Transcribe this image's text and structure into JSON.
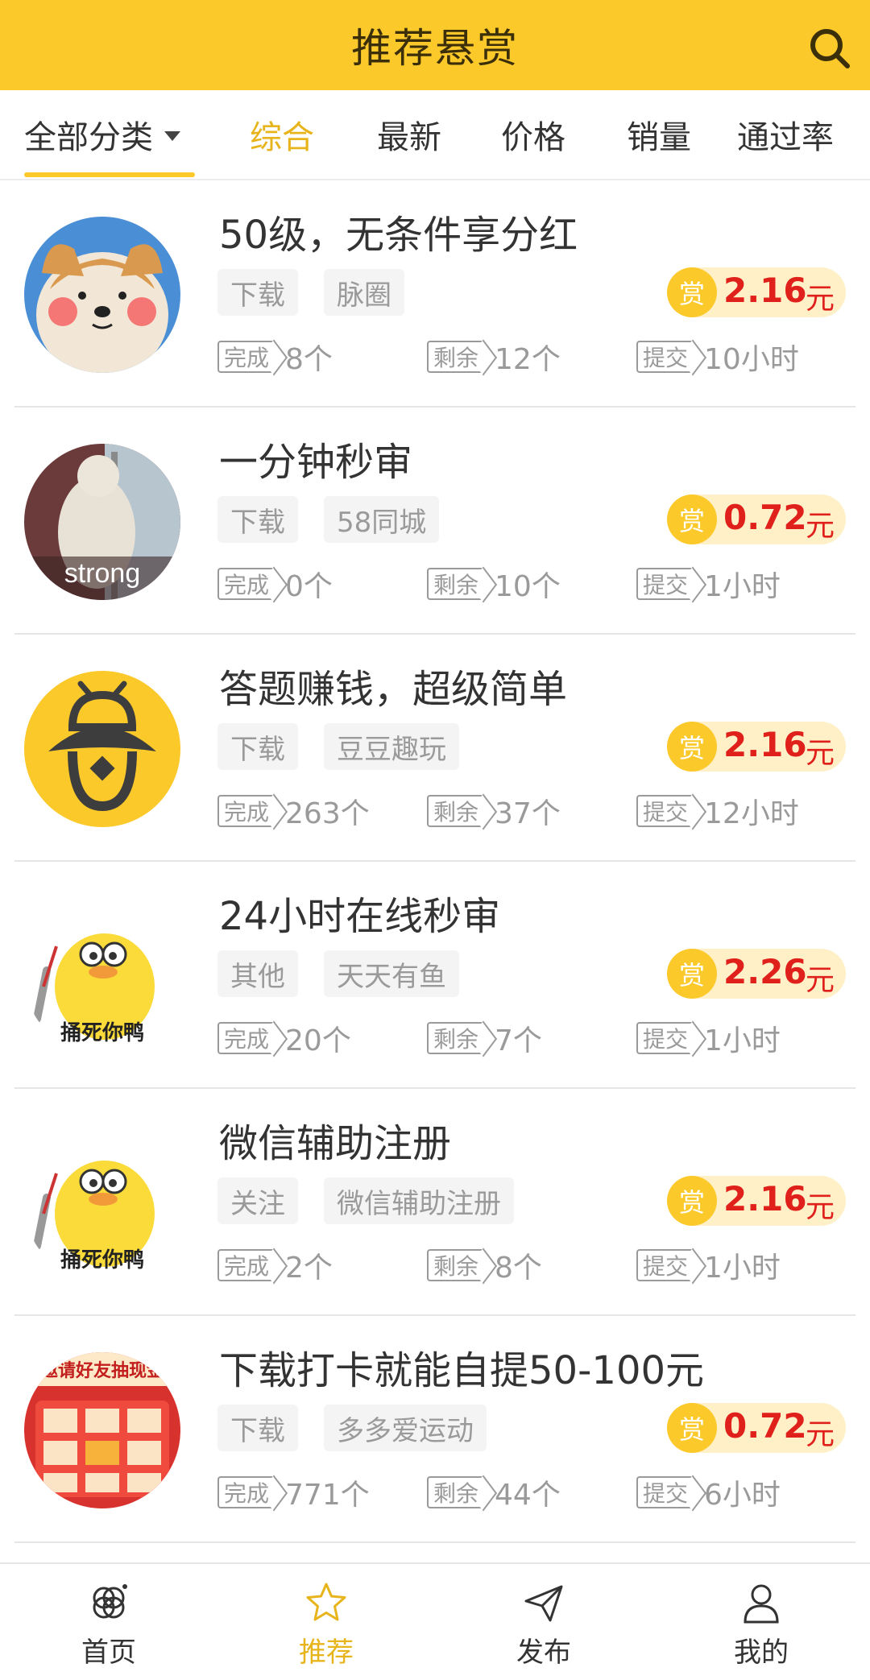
{
  "header": {
    "title": "推荐悬赏"
  },
  "tabs": {
    "all": "全部分类",
    "items": [
      "综合",
      "最新",
      "价格",
      "销量",
      "通过率"
    ]
  },
  "labels": {
    "done": "完成",
    "left": "剩余",
    "submit": "提交",
    "reward_coin": "赏",
    "currency": "元"
  },
  "tasks": [
    {
      "title": "50级，无条件享分红",
      "tag1": "下载",
      "tag2": "脉圈",
      "reward": "2.16",
      "done": "8个",
      "left": "12个",
      "submit": "10小时",
      "avatar": "shiba-dog-avatar"
    },
    {
      "title": "一分钟秒审",
      "tag1": "下载",
      "tag2": "58同城",
      "reward": "0.72",
      "done": "0个",
      "left": "10个",
      "submit": "1小时",
      "avatar": "strong-cat-avatar",
      "avatar_text": "strong"
    },
    {
      "title": "答题赚钱，超级简单",
      "tag1": "下载",
      "tag2": "豆豆趣玩",
      "reward": "2.16",
      "done": "263个",
      "left": "37个",
      "submit": "12小时",
      "avatar": "bee-logo-avatar"
    },
    {
      "title": "24小时在线秒审",
      "tag1": "其他",
      "tag2": "天天有鱼",
      "reward": "2.26",
      "done": "20个",
      "left": "7个",
      "submit": "1小时",
      "avatar": "duck-knife-avatar",
      "avatar_text": "捅死你鸭"
    },
    {
      "title": "微信辅助注册",
      "tag1": "关注",
      "tag2": "微信辅助注册",
      "reward": "2.16",
      "done": "2个",
      "left": "8个",
      "submit": "1小时",
      "avatar": "duck-knife-avatar",
      "avatar_text": "捅死你鸭"
    },
    {
      "title": "下载打卡就能自提50-100元",
      "tag1": "下载",
      "tag2": "多多爱运动",
      "reward": "0.72",
      "done": "771个",
      "left": "44个",
      "submit": "6小时",
      "avatar": "invite-friends-avatar",
      "avatar_text": "邀请好友抽现金"
    }
  ],
  "bottom_nav": [
    {
      "label": "首页",
      "icon": "home-icon"
    },
    {
      "label": "推荐",
      "icon": "star-icon",
      "active": true
    },
    {
      "label": "发布",
      "icon": "send-icon"
    },
    {
      "label": "我的",
      "icon": "user-icon"
    }
  ],
  "colors": {
    "brand": "#FCC92B",
    "active_text": "#E7B41C",
    "reward_red": "#E0201B"
  }
}
